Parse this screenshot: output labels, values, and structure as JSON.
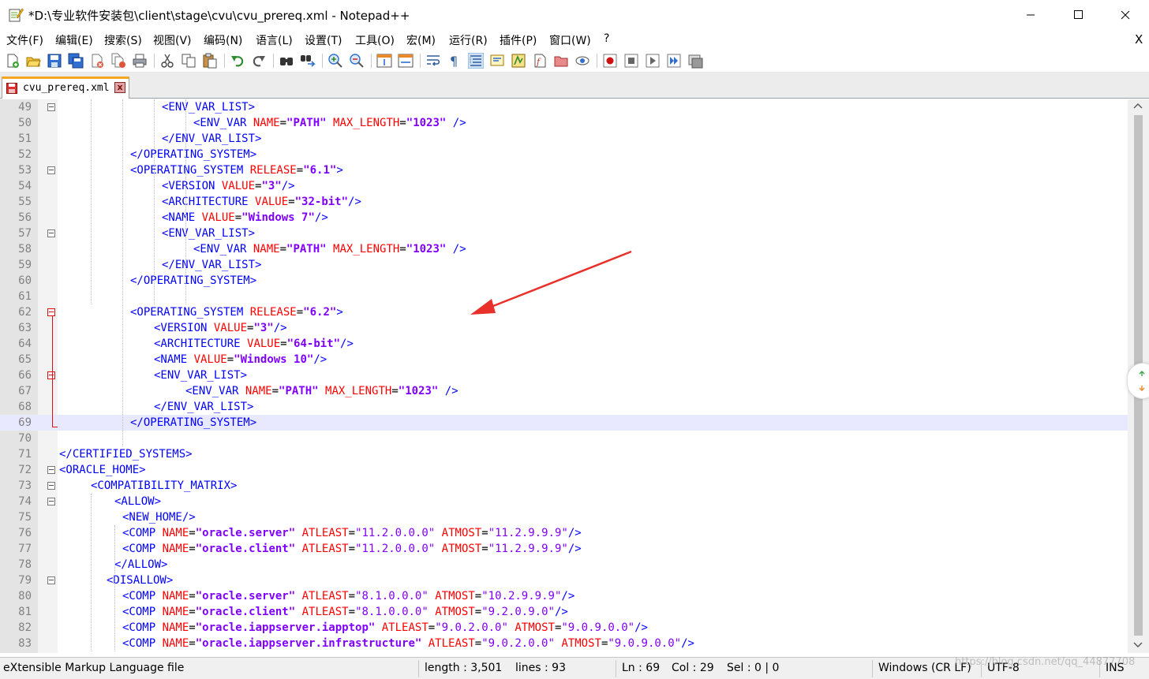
{
  "window": {
    "title": "*D:\\专业软件安装包\\client\\stage\\cvu\\cvu_prereq.xml - Notepad++",
    "minimize_symbol": "—",
    "maximize_symbol": "☐",
    "close_symbol": "✕"
  },
  "menu": {
    "items": [
      "文件(F)",
      "编辑(E)",
      "搜索(S)",
      "视图(V)",
      "编码(N)",
      "语言(L)",
      "设置(T)",
      "工具(O)",
      "宏(M)",
      "运行(R)",
      "插件(P)",
      "窗口(W)",
      "?"
    ],
    "close_doc": "X"
  },
  "toolbar": {
    "icons": [
      "new-file-icon",
      "open-file-icon",
      "save-icon",
      "save-all-icon",
      "close-icon",
      "close-all-icon",
      "print-icon",
      "cut-icon",
      "copy-icon",
      "paste-icon",
      "undo-icon",
      "redo-icon",
      "find-icon",
      "replace-icon",
      "zoom-in-icon",
      "zoom-out-icon",
      "sync-vertical-icon",
      "sync-horizontal-icon",
      "word-wrap-icon",
      "show-all-chars-icon",
      "indent-guide-icon",
      "user-language-icon",
      "doc-map-icon",
      "function-list-icon",
      "folder-workspace-icon",
      "monitor-icon",
      "record-macro-icon",
      "stop-macro-icon",
      "play-macro-icon",
      "run-macro-multiple-icon",
      "save-macro-icon"
    ]
  },
  "tabs": [
    {
      "label": "cvu_prereq.xml",
      "close": "x"
    }
  ],
  "editor": {
    "lines": [
      {
        "n": "49",
        "indent": 13,
        "parts": [
          [
            "tag",
            "<ENV_VAR_LIST>"
          ]
        ]
      },
      {
        "n": "50",
        "indent": 17,
        "parts": [
          [
            "tag",
            "<ENV_VAR "
          ],
          [
            "attr",
            "NAME"
          ],
          [
            "eq",
            "="
          ],
          [
            "val",
            "\"PATH\""
          ],
          [
            "tag",
            " "
          ],
          [
            "attr",
            "MAX_LENGTH"
          ],
          [
            "eq",
            "="
          ],
          [
            "val",
            "\"1023\""
          ],
          [
            "tag",
            " />"
          ]
        ]
      },
      {
        "n": "51",
        "indent": 13,
        "parts": [
          [
            "tag",
            "</ENV_VAR_LIST>"
          ]
        ]
      },
      {
        "n": "52",
        "indent": 9,
        "parts": [
          [
            "tag",
            "</OPERATING_SYSTEM>"
          ]
        ]
      },
      {
        "n": "53",
        "indent": 9,
        "parts": [
          [
            "tag",
            "<OPERATING_SYSTEM "
          ],
          [
            "attr",
            "RELEASE"
          ],
          [
            "eq",
            "="
          ],
          [
            "val",
            "\"6.1\""
          ],
          [
            "tag",
            ">"
          ]
        ]
      },
      {
        "n": "54",
        "indent": 13,
        "parts": [
          [
            "tag",
            "<VERSION "
          ],
          [
            "attr",
            "VALUE"
          ],
          [
            "eq",
            "="
          ],
          [
            "val",
            "\"3\""
          ],
          [
            "tag",
            "/>"
          ]
        ]
      },
      {
        "n": "55",
        "indent": 13,
        "parts": [
          [
            "tag",
            "<ARCHITECTURE "
          ],
          [
            "attr",
            "VALUE"
          ],
          [
            "eq",
            "="
          ],
          [
            "val",
            "\"32-bit\""
          ],
          [
            "tag",
            "/>"
          ]
        ]
      },
      {
        "n": "56",
        "indent": 13,
        "parts": [
          [
            "tag",
            "<NAME "
          ],
          [
            "attr",
            "VALUE"
          ],
          [
            "eq",
            "="
          ],
          [
            "val",
            "\"Windows 7\""
          ],
          [
            "tag",
            "/>"
          ]
        ]
      },
      {
        "n": "57",
        "indent": 13,
        "parts": [
          [
            "tag",
            "<ENV_VAR_LIST>"
          ]
        ]
      },
      {
        "n": "58",
        "indent": 17,
        "parts": [
          [
            "tag",
            "<ENV_VAR "
          ],
          [
            "attr",
            "NAME"
          ],
          [
            "eq",
            "="
          ],
          [
            "val",
            "\"PATH\""
          ],
          [
            "tag",
            " "
          ],
          [
            "attr",
            "MAX_LENGTH"
          ],
          [
            "eq",
            "="
          ],
          [
            "val",
            "\"1023\""
          ],
          [
            "tag",
            " />"
          ]
        ]
      },
      {
        "n": "59",
        "indent": 13,
        "parts": [
          [
            "tag",
            "</ENV_VAR_LIST>"
          ]
        ]
      },
      {
        "n": "60",
        "indent": 9,
        "parts": [
          [
            "tag",
            "</OPERATING_SYSTEM>"
          ]
        ]
      },
      {
        "n": "61",
        "indent": 0,
        "parts": []
      },
      {
        "n": "62",
        "indent": 9,
        "parts": [
          [
            "tag",
            "<OPERATING_SYSTEM "
          ],
          [
            "attr",
            "RELEASE"
          ],
          [
            "eq",
            "="
          ],
          [
            "val",
            "\"6.2\""
          ],
          [
            "tag",
            ">"
          ]
        ]
      },
      {
        "n": "63",
        "indent": 12,
        "parts": [
          [
            "tag",
            "<VERSION "
          ],
          [
            "attr",
            "VALUE"
          ],
          [
            "eq",
            "="
          ],
          [
            "val",
            "\"3\""
          ],
          [
            "tag",
            "/>"
          ]
        ]
      },
      {
        "n": "64",
        "indent": 12,
        "parts": [
          [
            "tag",
            "<ARCHITECTURE "
          ],
          [
            "attr",
            "VALUE"
          ],
          [
            "eq",
            "="
          ],
          [
            "val",
            "\"64-bit\""
          ],
          [
            "tag",
            "/>"
          ]
        ]
      },
      {
        "n": "65",
        "indent": 12,
        "parts": [
          [
            "tag",
            "<NAME "
          ],
          [
            "attr",
            "VALUE"
          ],
          [
            "eq",
            "="
          ],
          [
            "val",
            "\"Windows 10\""
          ],
          [
            "tag",
            "/>"
          ]
        ]
      },
      {
        "n": "66",
        "indent": 12,
        "parts": [
          [
            "tag",
            "<ENV_VAR_LIST>"
          ]
        ]
      },
      {
        "n": "67",
        "indent": 16,
        "parts": [
          [
            "tag",
            "<ENV_VAR "
          ],
          [
            "attr",
            "NAME"
          ],
          [
            "eq",
            "="
          ],
          [
            "val",
            "\"PATH\""
          ],
          [
            "tag",
            " "
          ],
          [
            "attr",
            "MAX_LENGTH"
          ],
          [
            "eq",
            "="
          ],
          [
            "val",
            "\"1023\""
          ],
          [
            "tag",
            " />"
          ]
        ]
      },
      {
        "n": "68",
        "indent": 12,
        "parts": [
          [
            "tag",
            "</ENV_VAR_LIST>"
          ]
        ]
      },
      {
        "n": "69",
        "indent": 9,
        "parts": [
          [
            "tag",
            "</OPERATING_SYSTEM>"
          ]
        ]
      },
      {
        "n": "70",
        "indent": 0,
        "parts": []
      },
      {
        "n": "71",
        "indent": 0,
        "parts": [
          [
            "tag",
            "</CERTIFIED_SYSTEMS>"
          ]
        ]
      },
      {
        "n": "72",
        "indent": 0,
        "parts": [
          [
            "tag",
            "<ORACLE_HOME>"
          ]
        ]
      },
      {
        "n": "73",
        "indent": 4,
        "parts": [
          [
            "tag",
            "<COMPATIBILITY_MATRIX>"
          ]
        ]
      },
      {
        "n": "74",
        "indent": 7,
        "parts": [
          [
            "tag",
            "<ALLOW>"
          ]
        ]
      },
      {
        "n": "75",
        "indent": 8,
        "parts": [
          [
            "tag",
            "<NEW_HOME/>"
          ]
        ]
      },
      {
        "n": "76",
        "indent": 8,
        "parts": [
          [
            "tag",
            "<COMP "
          ],
          [
            "attr",
            "NAME"
          ],
          [
            "eq",
            "="
          ],
          [
            "val",
            "\"oracle.server\""
          ],
          [
            "tag",
            " "
          ],
          [
            "attr",
            "ATLEAST"
          ],
          [
            "eq",
            "="
          ],
          [
            "q",
            "\"11.2.0.0.0\""
          ],
          [
            "tag",
            " "
          ],
          [
            "attr",
            "ATMOST"
          ],
          [
            "eq",
            "="
          ],
          [
            "q",
            "\"11.2.9.9.9\""
          ],
          [
            "tag",
            "/>"
          ]
        ]
      },
      {
        "n": "77",
        "indent": 8,
        "parts": [
          [
            "tag",
            "<COMP "
          ],
          [
            "attr",
            "NAME"
          ],
          [
            "eq",
            "="
          ],
          [
            "val",
            "\"oracle.client\""
          ],
          [
            "tag",
            " "
          ],
          [
            "attr",
            "ATLEAST"
          ],
          [
            "eq",
            "="
          ],
          [
            "q",
            "\"11.2.0.0.0\""
          ],
          [
            "tag",
            " "
          ],
          [
            "attr",
            "ATMOST"
          ],
          [
            "eq",
            "="
          ],
          [
            "q",
            "\"11.2.9.9.9\""
          ],
          [
            "tag",
            "/>"
          ]
        ]
      },
      {
        "n": "78",
        "indent": 7,
        "parts": [
          [
            "tag",
            "</ALLOW>"
          ]
        ]
      },
      {
        "n": "79",
        "indent": 6,
        "parts": [
          [
            "tag",
            "<DISALLOW>"
          ]
        ]
      },
      {
        "n": "80",
        "indent": 8,
        "parts": [
          [
            "tag",
            "<COMP "
          ],
          [
            "attr",
            "NAME"
          ],
          [
            "eq",
            "="
          ],
          [
            "val",
            "\"oracle.server\""
          ],
          [
            "tag",
            " "
          ],
          [
            "attr",
            "ATLEAST"
          ],
          [
            "eq",
            "="
          ],
          [
            "q",
            "\"8.1.0.0.0\""
          ],
          [
            "tag",
            " "
          ],
          [
            "attr",
            "ATMOST"
          ],
          [
            "eq",
            "="
          ],
          [
            "q",
            "\"10.2.9.9.9\""
          ],
          [
            "tag",
            "/>"
          ]
        ]
      },
      {
        "n": "81",
        "indent": 8,
        "parts": [
          [
            "tag",
            "<COMP "
          ],
          [
            "attr",
            "NAME"
          ],
          [
            "eq",
            "="
          ],
          [
            "val",
            "\"oracle.client\""
          ],
          [
            "tag",
            " "
          ],
          [
            "attr",
            "ATLEAST"
          ],
          [
            "eq",
            "="
          ],
          [
            "q",
            "\"8.1.0.0.0\""
          ],
          [
            "tag",
            " "
          ],
          [
            "attr",
            "ATMOST"
          ],
          [
            "eq",
            "="
          ],
          [
            "q",
            "\"9.2.0.9.0\""
          ],
          [
            "tag",
            "/>"
          ]
        ]
      },
      {
        "n": "82",
        "indent": 8,
        "parts": [
          [
            "tag",
            "<COMP "
          ],
          [
            "attr",
            "NAME"
          ],
          [
            "eq",
            "="
          ],
          [
            "val",
            "\"oracle.iappserver.iapptop\""
          ],
          [
            "tag",
            " "
          ],
          [
            "attr",
            "ATLEAST"
          ],
          [
            "eq",
            "="
          ],
          [
            "q",
            "\"9.0.2.0.0\""
          ],
          [
            "tag",
            " "
          ],
          [
            "attr",
            "ATMOST"
          ],
          [
            "eq",
            "="
          ],
          [
            "q",
            "\"9.0.9.0.0\""
          ],
          [
            "tag",
            "/>"
          ]
        ]
      },
      {
        "n": "83",
        "indent": 8,
        "parts": [
          [
            "tag",
            "<COMP "
          ],
          [
            "attr",
            "NAME"
          ],
          [
            "eq",
            "="
          ],
          [
            "val",
            "\"oracle.iappserver.infrastructure\""
          ],
          [
            "tag",
            " "
          ],
          [
            "attr",
            "ATLEAST"
          ],
          [
            "eq",
            "="
          ],
          [
            "q",
            "\"9.0.2.0.0\""
          ],
          [
            "tag",
            " "
          ],
          [
            "attr",
            "ATMOST"
          ],
          [
            "eq",
            "="
          ],
          [
            "q",
            "\"9.0.9.0.0\""
          ],
          [
            "tag",
            "/>"
          ]
        ]
      }
    ],
    "highlighted_line": "69",
    "fold_lines": [
      "49",
      "53",
      "57",
      "62",
      "66",
      "72",
      "73",
      "74",
      "79"
    ],
    "red_fold_lines": [
      "62",
      "66"
    ]
  },
  "colors": {
    "tag": "#0000ff",
    "attribute": "#ff0000",
    "value": "#8000ff",
    "current_line": "#e8e8ff",
    "annotation_arrow": "#e8312a"
  },
  "statusbar": {
    "file_type": "eXtensible Markup Language file",
    "length": "length : 3,501",
    "lines": "lines : 93",
    "ln": "Ln : 69",
    "col": "Col : 29",
    "sel": "Sel : 0 | 0",
    "eol": "Windows (CR LF)",
    "encoding": "UTF-8",
    "mode": "INS"
  },
  "watermark": "https://blog.csdn.net/qq_44877708"
}
